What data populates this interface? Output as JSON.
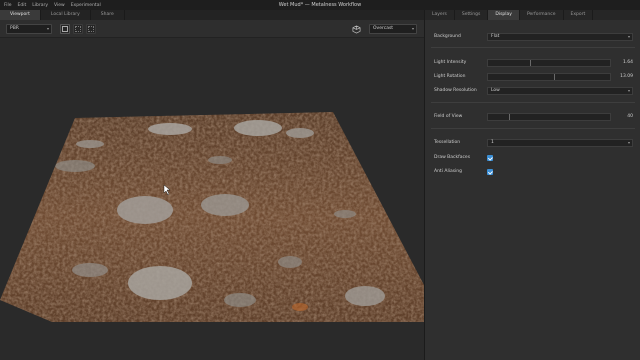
{
  "app": {
    "menu": [
      "File",
      "Edit",
      "Library",
      "View",
      "Experimental"
    ],
    "title": "Wet Mud* — Metalness Workflow"
  },
  "viewport": {
    "tabs": [
      "Viewport",
      "Local Library",
      "Share"
    ],
    "active_tab": "Viewport",
    "render_mode": "PBR",
    "environment": "Overcast"
  },
  "panel": {
    "tabs": [
      "Layers",
      "Settings",
      "Display",
      "Performance",
      "Export"
    ],
    "active_tab": "Display",
    "background": {
      "label": "Background",
      "value": "Flat"
    },
    "light_intensity": {
      "label": "Light Intensity",
      "value": "1.64"
    },
    "light_rotation": {
      "label": "Light Rotation",
      "value": "13.09"
    },
    "shadow_resolution": {
      "label": "Shadow Resolution",
      "value": "Low"
    },
    "field_of_view": {
      "label": "Field of View",
      "value": "40"
    },
    "tessellation": {
      "label": "Tessellation",
      "value": "1"
    },
    "draw_backfaces": {
      "label": "Draw Backfaces",
      "checked": true
    },
    "anti_aliasing": {
      "label": "Anti Aliasing",
      "checked": true
    }
  },
  "colors": {
    "accent": "#3b8fd6",
    "mud": "#6b4a33",
    "puddle": "#9c9a97"
  },
  "icons": {
    "render_mode": "chevron-down-icon",
    "environment": "chevron-down-icon",
    "camera_cube": "cube-icon"
  }
}
